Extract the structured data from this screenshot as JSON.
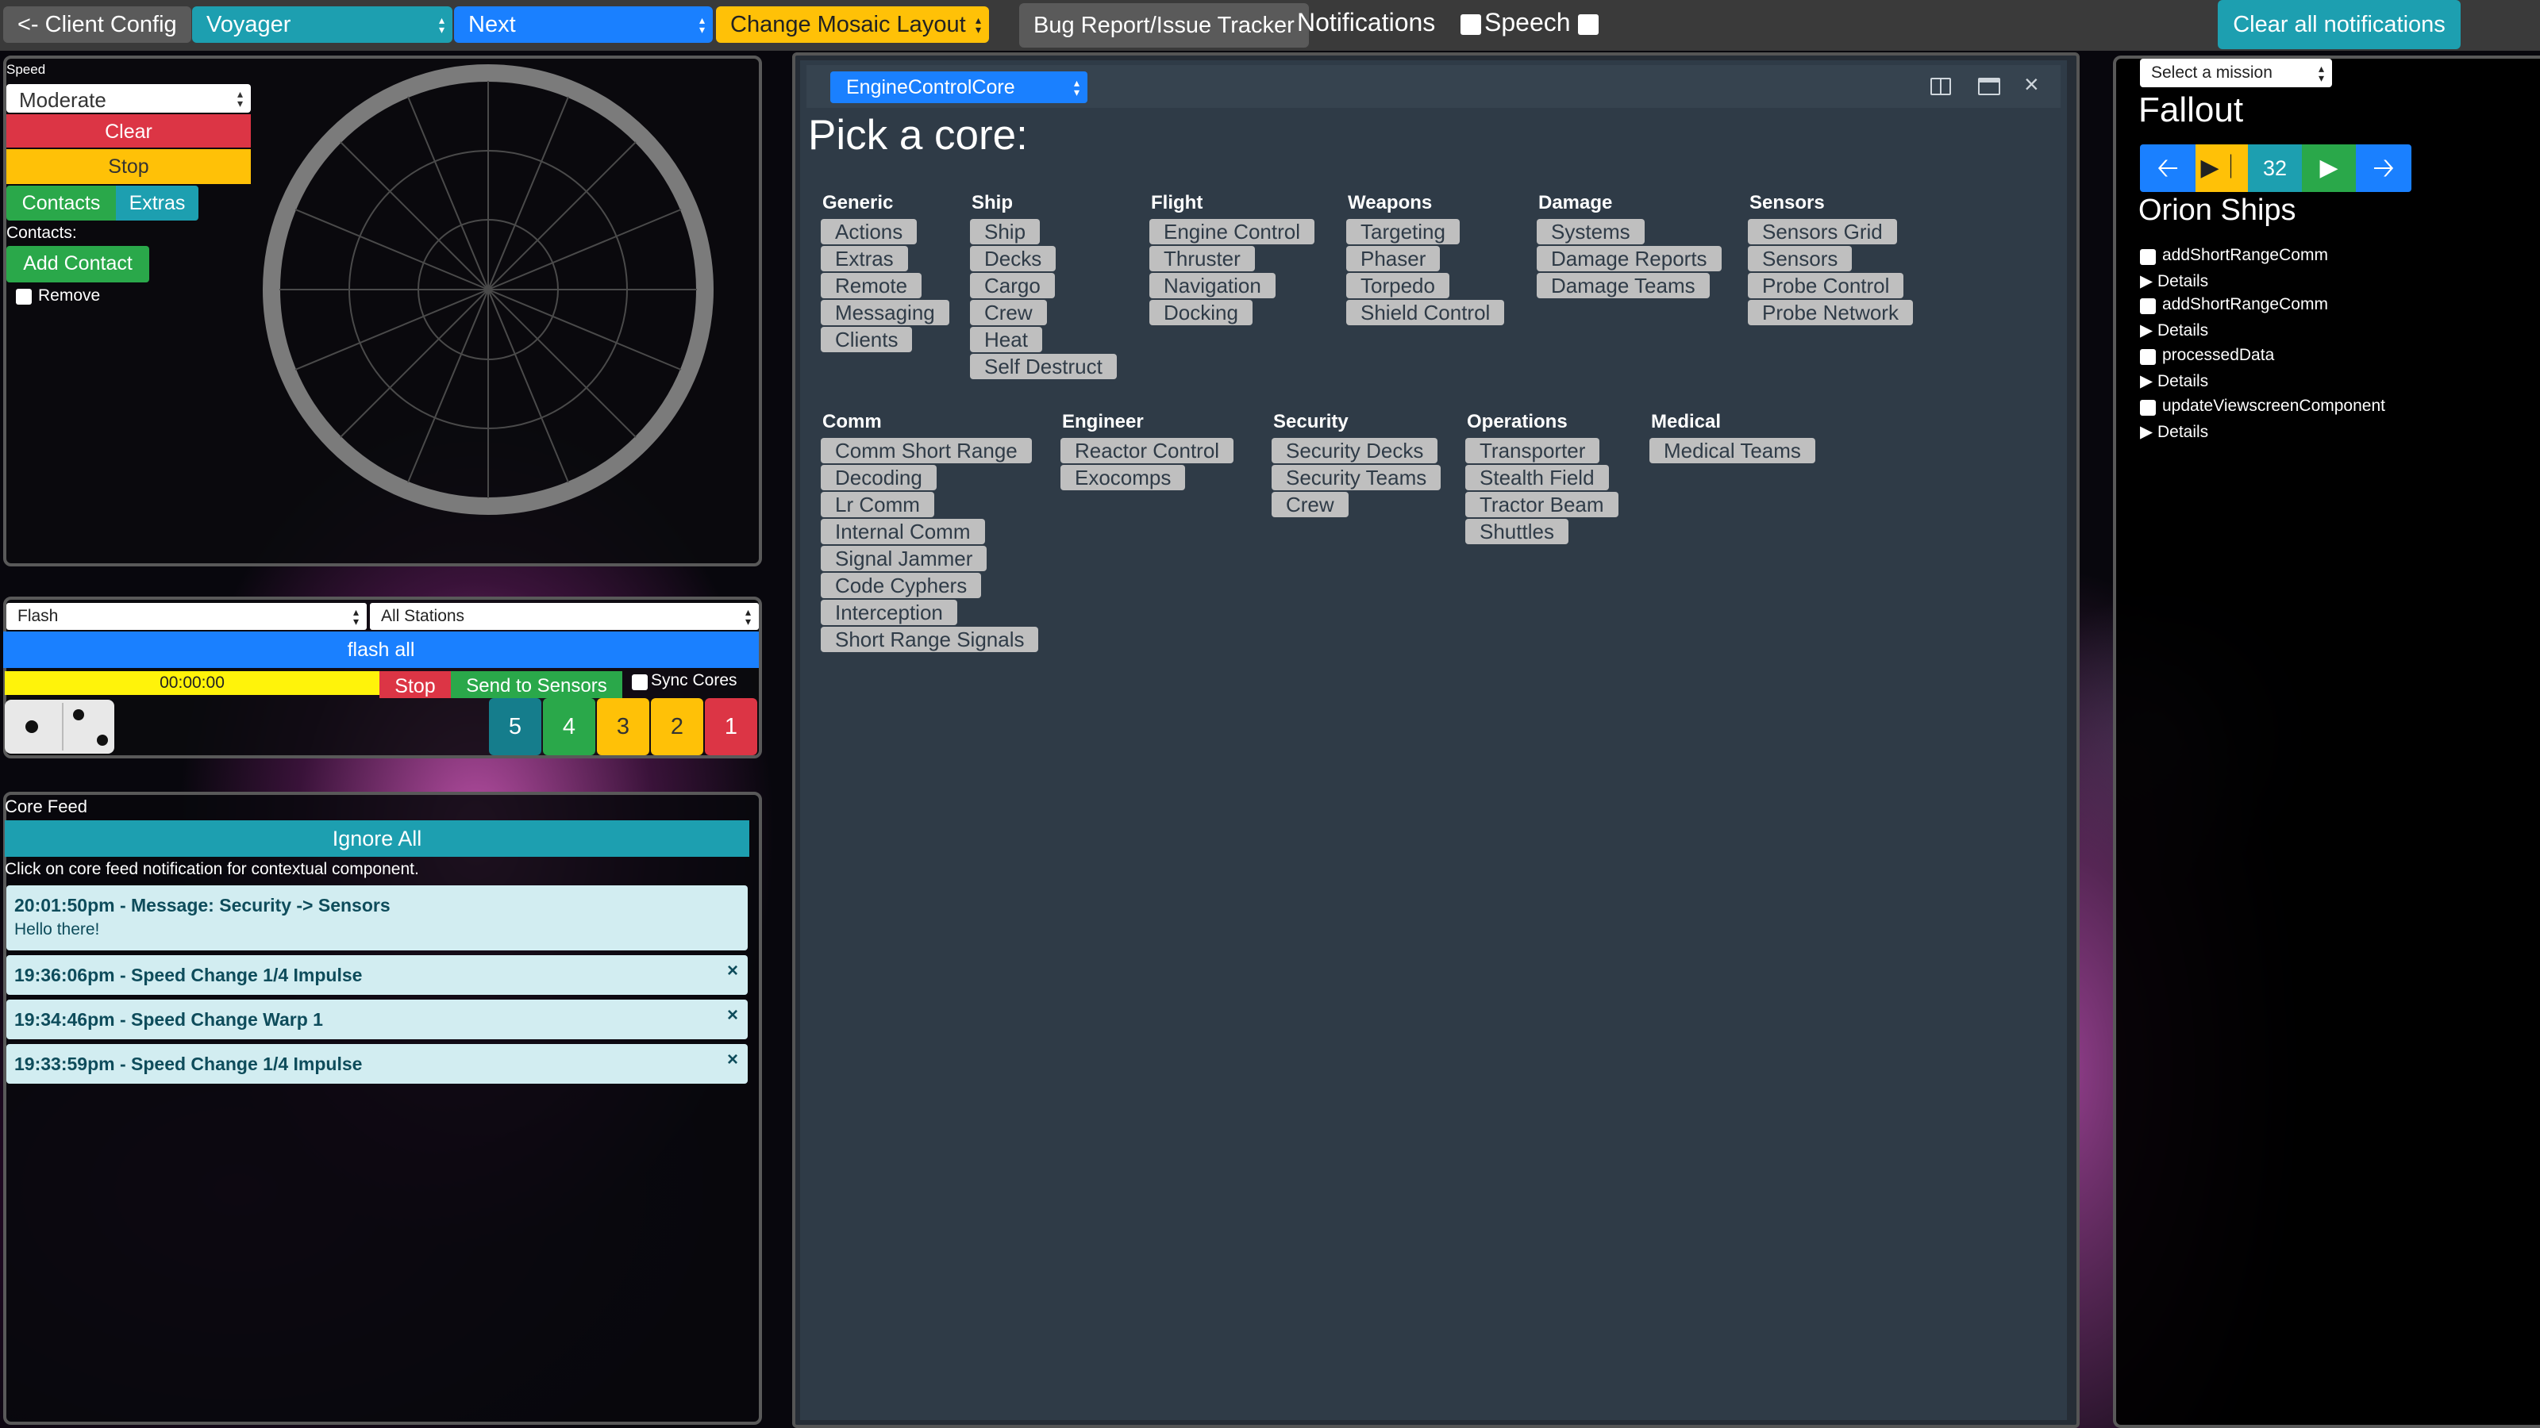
{
  "topbar": {
    "client_config": "<- Client Config",
    "simulator": "Voyager",
    "next": "Next",
    "mosaic": "Change Mosaic Layout",
    "bug_report": "Bug Report/Issue Tracker",
    "notifications": "Notifications",
    "speech": "Speech",
    "clear_notifications": "Clear all notifications"
  },
  "sensors": {
    "speed_label": "Speed",
    "speed_value": "Moderate",
    "clear": "Clear",
    "stop": "Stop",
    "contacts_tab": "Contacts",
    "extras_tab": "Extras",
    "contacts_label": "Contacts:",
    "add_contact": "Add Contact",
    "remove": "Remove"
  },
  "flash": {
    "mode": "Flash",
    "stations": "All Stations",
    "flash_all": "flash all",
    "timer": "00:00:00",
    "stop": "Stop",
    "send_to_sensors": "Send to Sensors",
    "sync_cores": "Sync Cores",
    "countdown": [
      "5",
      "4",
      "3",
      "2",
      "1"
    ]
  },
  "feed": {
    "title": "Core Feed",
    "ignore_all": "Ignore All",
    "hint": "Click on core feed notification for contextual component.",
    "items": [
      {
        "title": "20:01:50pm - Message: Security -> Sensors",
        "body": "Hello there!"
      },
      {
        "title": "19:36:06pm - Speed Change 1/4 Impulse"
      },
      {
        "title": "19:34:46pm - Speed Change Warp 1"
      },
      {
        "title": "19:33:59pm - Speed Change 1/4 Impulse"
      }
    ]
  },
  "center": {
    "core_select": "EngineControlCore",
    "heading": "Pick a core:",
    "groups": [
      {
        "name": "Generic",
        "items": [
          "Actions",
          "Extras",
          "Remote",
          "Messaging",
          "Clients"
        ]
      },
      {
        "name": "Ship",
        "items": [
          "Ship",
          "Decks",
          "Cargo",
          "Crew",
          "Heat",
          "Self Destruct"
        ]
      },
      {
        "name": "Flight",
        "items": [
          "Engine Control",
          "Thruster",
          "Navigation",
          "Docking"
        ]
      },
      {
        "name": "Weapons",
        "items": [
          "Targeting",
          "Phaser",
          "Torpedo",
          "Shield Control"
        ]
      },
      {
        "name": "Damage",
        "items": [
          "Systems",
          "Damage Reports",
          "Damage Teams"
        ]
      },
      {
        "name": "Sensors",
        "items": [
          "Sensors Grid",
          "Sensors",
          "Probe Control",
          "Probe Network"
        ]
      },
      {
        "name": "Comm",
        "items": [
          "Comm Short Range",
          "Decoding",
          "Lr Comm",
          "Internal Comm",
          "Signal Jammer",
          "Code Cyphers",
          "Interception",
          "Short Range Signals"
        ]
      },
      {
        "name": "Engineer",
        "items": [
          "Reactor Control",
          "Exocomps"
        ]
      },
      {
        "name": "Security",
        "items": [
          "Security Decks",
          "Security Teams",
          "Crew"
        ]
      },
      {
        "name": "Operations",
        "items": [
          "Transporter",
          "Stealth Field",
          "Tractor Beam",
          "Shuttles"
        ]
      },
      {
        "name": "Medical",
        "items": [
          "Medical Teams"
        ]
      }
    ]
  },
  "mission": {
    "select": "Select a mission",
    "name": "Fallout",
    "counter": "32",
    "ships": "Orion Ships",
    "details": "Details",
    "steps": [
      "addShortRangeComm",
      "addShortRangeComm",
      "processedData",
      "updateViewscreenComponent"
    ]
  },
  "colors": {
    "blue": "#1a80ff",
    "teal": "#1d9fb0",
    "green": "#2aa84a",
    "red": "#dc3545",
    "yellow": "#ffc107",
    "panel_center": "#2f3b47"
  }
}
